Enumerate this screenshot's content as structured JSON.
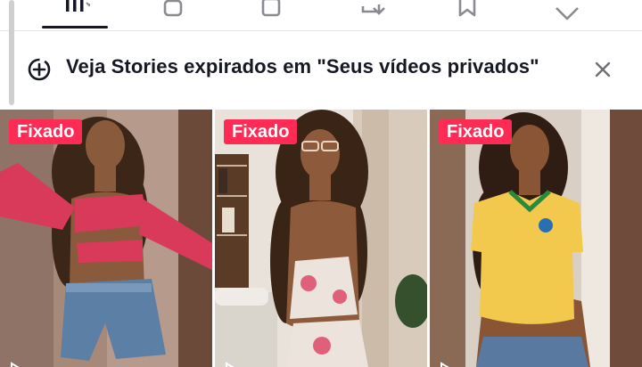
{
  "tabs": [
    {
      "icon": "grid-icon",
      "active": true
    },
    {
      "icon": "lock-icon",
      "active": false
    },
    {
      "icon": "box-icon",
      "active": false
    },
    {
      "icon": "repost-icon",
      "active": false
    },
    {
      "icon": "bookmark-icon",
      "active": false
    },
    {
      "icon": "heart-icon",
      "active": false
    }
  ],
  "banner": {
    "icon": "add-story-icon",
    "text": "Veja Stories expirados em \"Seus vídeos privados\"",
    "close_icon": "close-icon"
  },
  "videos": [
    {
      "badge": "Fixado",
      "icon": "play-icon"
    },
    {
      "badge": "Fixado",
      "icon": "play-icon"
    },
    {
      "badge": "Fixado",
      "icon": "play-icon"
    }
  ],
  "colors": {
    "accent": "#fe2c55",
    "text": "#161823",
    "divider": "#e6e6e6"
  }
}
